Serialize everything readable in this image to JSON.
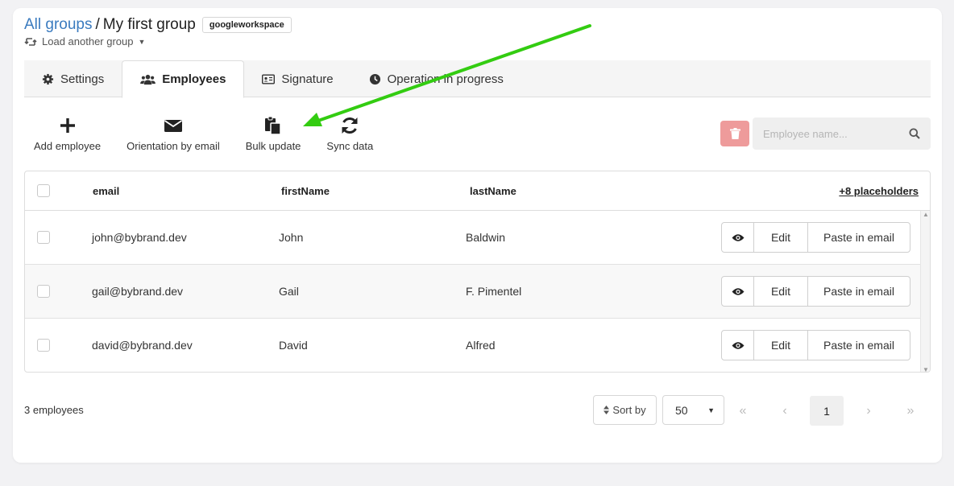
{
  "header": {
    "all_groups": "All groups",
    "separator": "/",
    "group_name": "My first group",
    "tag": "googleworkspace",
    "load_another": "Load another group"
  },
  "tabs": [
    {
      "label": "Settings",
      "icon": "gear-icon"
    },
    {
      "label": "Employees",
      "icon": "users-icon",
      "active": true
    },
    {
      "label": "Signature",
      "icon": "id-card-icon"
    },
    {
      "label": "Operation in progress",
      "icon": "clock-icon"
    }
  ],
  "toolbar": {
    "add_employee": "Add employee",
    "orientation": "Orientation by email",
    "bulk_update": "Bulk update",
    "sync_data": "Sync data"
  },
  "search": {
    "placeholder": "Employee name..."
  },
  "table": {
    "columns": [
      "email",
      "firstName",
      "lastName"
    ],
    "placeholders_link": "+8 placeholders",
    "rows": [
      {
        "email": "john@bybrand.dev",
        "firstName": "John",
        "lastName": "Baldwin"
      },
      {
        "email": "gail@bybrand.dev",
        "firstName": "Gail",
        "lastName": "F. Pimentel"
      },
      {
        "email": "david@bybrand.dev",
        "firstName": "David",
        "lastName": "Alfred"
      }
    ],
    "edit_label": "Edit",
    "paste_label": "Paste in email"
  },
  "footer": {
    "count": "3 employees",
    "sort_by": "Sort by",
    "per_page": "50",
    "pager": {
      "first": "«",
      "prev": "‹",
      "current": "1",
      "next": "›",
      "last": "»"
    }
  },
  "colors": {
    "link": "#3a7bbf",
    "danger": "#ee9b9b",
    "annotation_arrow": "#33cc11"
  }
}
